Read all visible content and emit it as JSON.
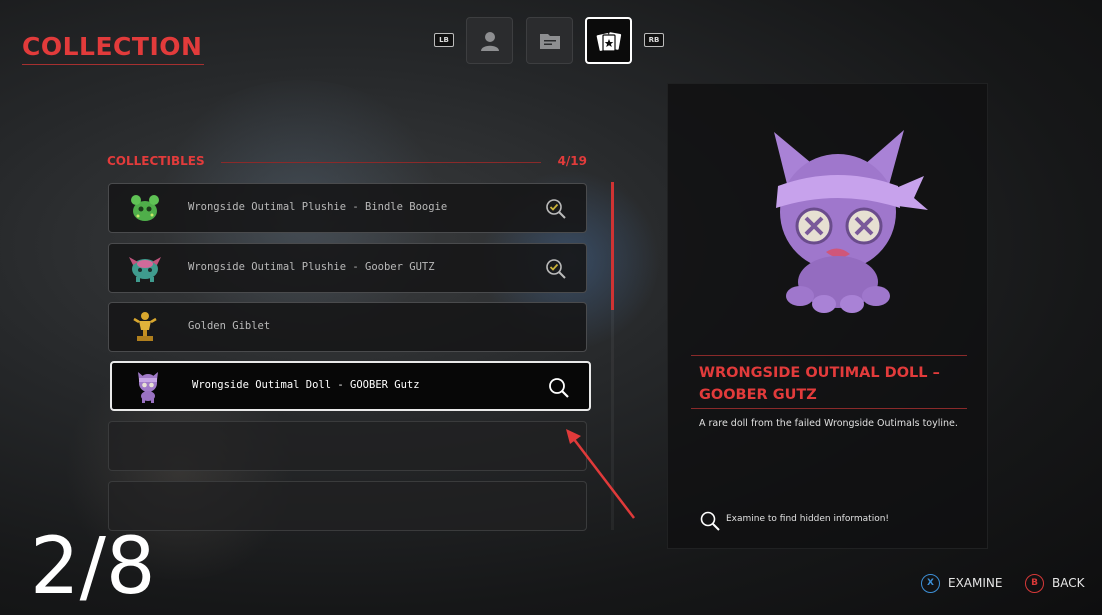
{
  "screen": {
    "title": "COLLECTION",
    "accent_color": "#e23b3b"
  },
  "tabs": {
    "left_hint": "LB",
    "right_hint": "RB",
    "items": [
      {
        "icon": "profile-icon",
        "active": false
      },
      {
        "icon": "folder-icon",
        "active": false
      },
      {
        "icon": "collectible-cards-icon",
        "active": true
      }
    ]
  },
  "collectibles": {
    "header": "COLLECTIBLES",
    "count": "4/19",
    "items": [
      {
        "label": "Wrongside Outimal Plushie - Bindle Boogie",
        "icon": "green-plushie-icon",
        "status": "examined-check-icon"
      },
      {
        "label": "Wrongside Outimal Plushie - Goober GUTZ",
        "icon": "teal-plushie-icon",
        "status": "examined-check-icon"
      },
      {
        "label": "Golden Giblet",
        "icon": "golden-trophy-icon",
        "status": ""
      },
      {
        "label": "Wrongside Outimal Doll - GOOBER Gutz",
        "icon": "purple-doll-icon",
        "status": "examine-icon"
      }
    ]
  },
  "detail": {
    "name": "WRONGSIDE OUTIMAL DOLL – GOOBER GUTZ",
    "description": "A rare doll from the failed Wrongside Outimals toyline.",
    "hint": "Examine to find hidden information!"
  },
  "overlay": {
    "step": "2/8"
  },
  "prompts": {
    "examine": {
      "button": "X",
      "label": "EXAMINE",
      "color": "#3d8fd6"
    },
    "back": {
      "button": "B",
      "label": "BACK",
      "color": "#d63838"
    }
  }
}
